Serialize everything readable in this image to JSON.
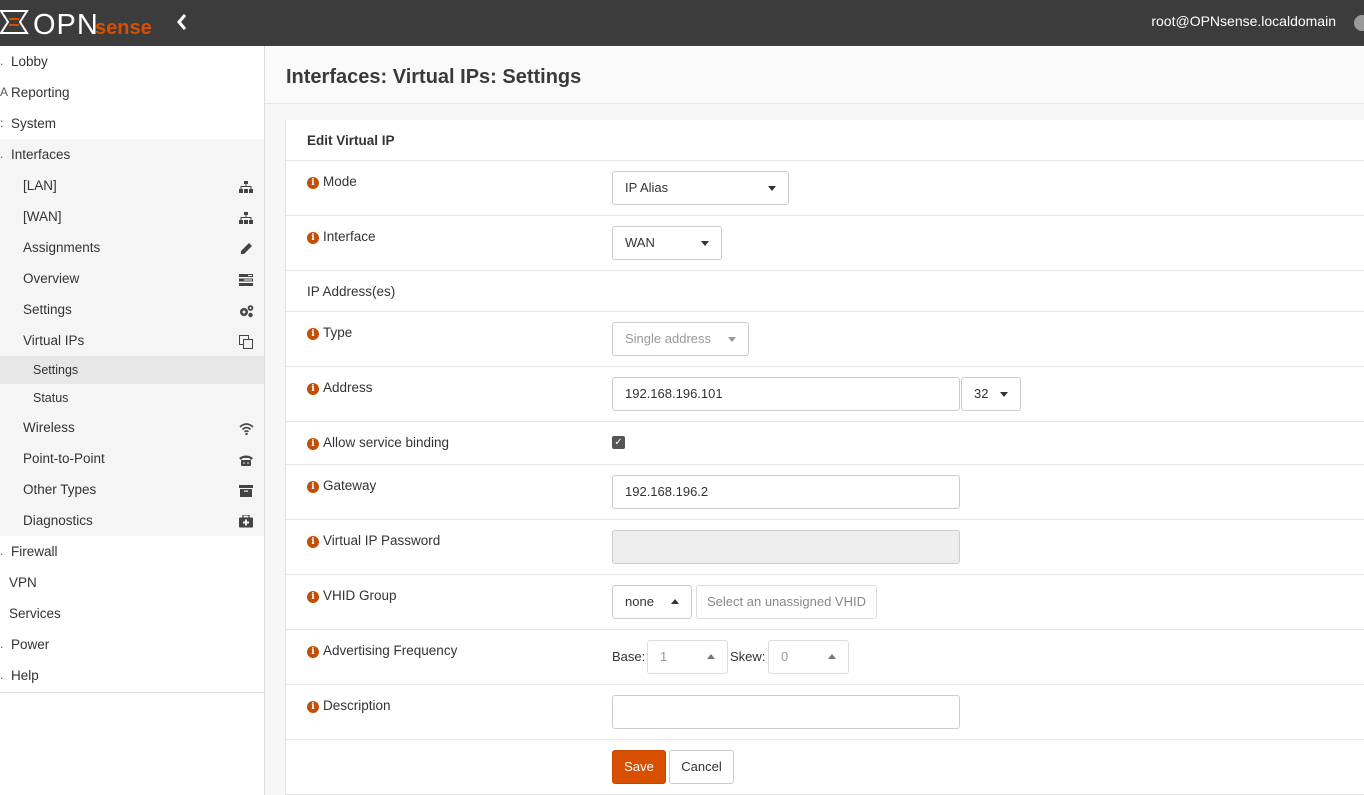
{
  "header": {
    "logo_text_left": "OPN",
    "logo_text_right": "sense",
    "user": "root@OPNsense.localdomain"
  },
  "sidebar": {
    "items": [
      {
        "label": "Lobby"
      },
      {
        "label": "Reporting"
      },
      {
        "label": "System"
      },
      {
        "label": "Interfaces"
      },
      {
        "label": "[LAN]",
        "icon": "sitemap-icon"
      },
      {
        "label": "[WAN]",
        "icon": "sitemap-icon"
      },
      {
        "label": "Assignments",
        "icon": "pencil-icon"
      },
      {
        "label": "Overview",
        "icon": "tasks-icon"
      },
      {
        "label": "Settings",
        "icon": "cogs-icon"
      },
      {
        "label": "Virtual IPs",
        "icon": "clone-icon"
      },
      {
        "label": "Settings"
      },
      {
        "label": "Status"
      },
      {
        "label": "Wireless",
        "icon": "wifi-icon"
      },
      {
        "label": "Point-to-Point",
        "icon": "phone-icon"
      },
      {
        "label": "Other Types",
        "icon": "archive-icon"
      },
      {
        "label": "Diagnostics",
        "icon": "medkit-icon"
      },
      {
        "label": "Firewall"
      },
      {
        "label": "VPN"
      },
      {
        "label": "Services"
      },
      {
        "label": "Power"
      },
      {
        "label": "Help"
      }
    ]
  },
  "page": {
    "title": "Interfaces: Virtual IPs: Settings"
  },
  "form": {
    "section_title": "Edit Virtual IP",
    "mode_label": "Mode",
    "mode_value": "IP Alias",
    "interface_label": "Interface",
    "interface_value": "WAN",
    "ip_section": "IP Address(es)",
    "type_label": "Type",
    "type_value": "Single address",
    "address_label": "Address",
    "address_value": "192.168.196.101",
    "cidr_value": "32",
    "binding_label": "Allow service binding",
    "binding_checked": true,
    "gateway_label": "Gateway",
    "gateway_value": "192.168.196.2",
    "password_label": "Virtual IP Password",
    "password_value": "",
    "vhid_label": "VHID Group",
    "vhid_value": "none",
    "vhid_button": "Select an unassigned VHID",
    "advfreq_label": "Advertising Frequency",
    "base_label": "Base:",
    "base_value": "1",
    "skew_label": "Skew:",
    "skew_value": "0",
    "description_label": "Description",
    "description_value": "",
    "save_label": "Save",
    "cancel_label": "Cancel"
  },
  "colors": {
    "accent": "#d94f00",
    "topbar": "#3c3c3c",
    "info_icon": "#c14f07"
  }
}
